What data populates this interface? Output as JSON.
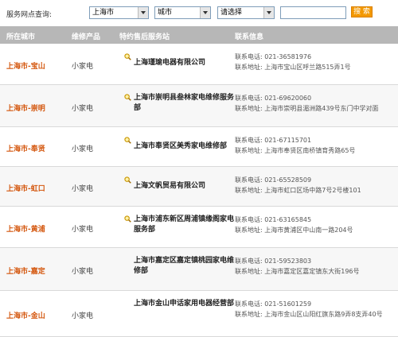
{
  "search": {
    "label": "服务网点查询:",
    "province_value": "上海市",
    "city_value": "城市",
    "district_value": "请选择",
    "keyword_value": "",
    "button_label": "搜 索"
  },
  "table": {
    "headers": [
      "所在城市",
      "维修产品",
      "特约售后服务站",
      "联系信息"
    ],
    "rows": [
      {
        "city": "上海市-宝山",
        "product": "小家电",
        "name": "上海瑾瑜电器有限公司",
        "phone": "联系电话: 021-36581976",
        "address": "联系地址: 上海市宝山区呼兰路515弄1号",
        "has_icon": true
      },
      {
        "city": "上海市-崇明",
        "product": "小家电",
        "name": "上海市崇明县叁林家电维修服务部",
        "phone": "联系电话: 021-69620060",
        "address": "联系地址: 上海市崇明县湄洲路439号东门中学对面",
        "has_icon": true
      },
      {
        "city": "上海市-奉贤",
        "product": "小家电",
        "name": "上海市奉贤区美秀家电维修部",
        "phone": "联系电话: 021-67115701",
        "address": "联系地址: 上海市奉贤区南桥镇育秀路65号",
        "has_icon": true
      },
      {
        "city": "上海市-虹口",
        "product": "小家电",
        "name": "上海文帆贸易有限公司",
        "phone": "联系电话: 021-65528509",
        "address": "联系地址: 上海市虹口区场中路7号2号楼101",
        "has_icon": true
      },
      {
        "city": "上海市-黄浦",
        "product": "小家电",
        "name": "上海市浦东新区周浦镇缘阁家电服务部",
        "phone": "联系电话: 021-63165845",
        "address": "联系地址: 上海市黄浦区中山南一路204号",
        "has_icon": true
      },
      {
        "city": "上海市-嘉定",
        "product": "小家电",
        "name": "上海市嘉定区嘉定镇桃园家电维修部",
        "phone": "联系电话: 021-59523803",
        "address": "联系地址: 上海市嘉定区嘉定镇东大街196号",
        "has_icon": false
      },
      {
        "city": "上海市-金山",
        "product": "小家电",
        "name": "上海市金山申话家用电器经营部",
        "phone": "联系电话: 021-51601259",
        "address": "联系地址: 上海市金山区山阳红旗东路9弄8支弄40号",
        "has_icon": false
      }
    ]
  }
}
